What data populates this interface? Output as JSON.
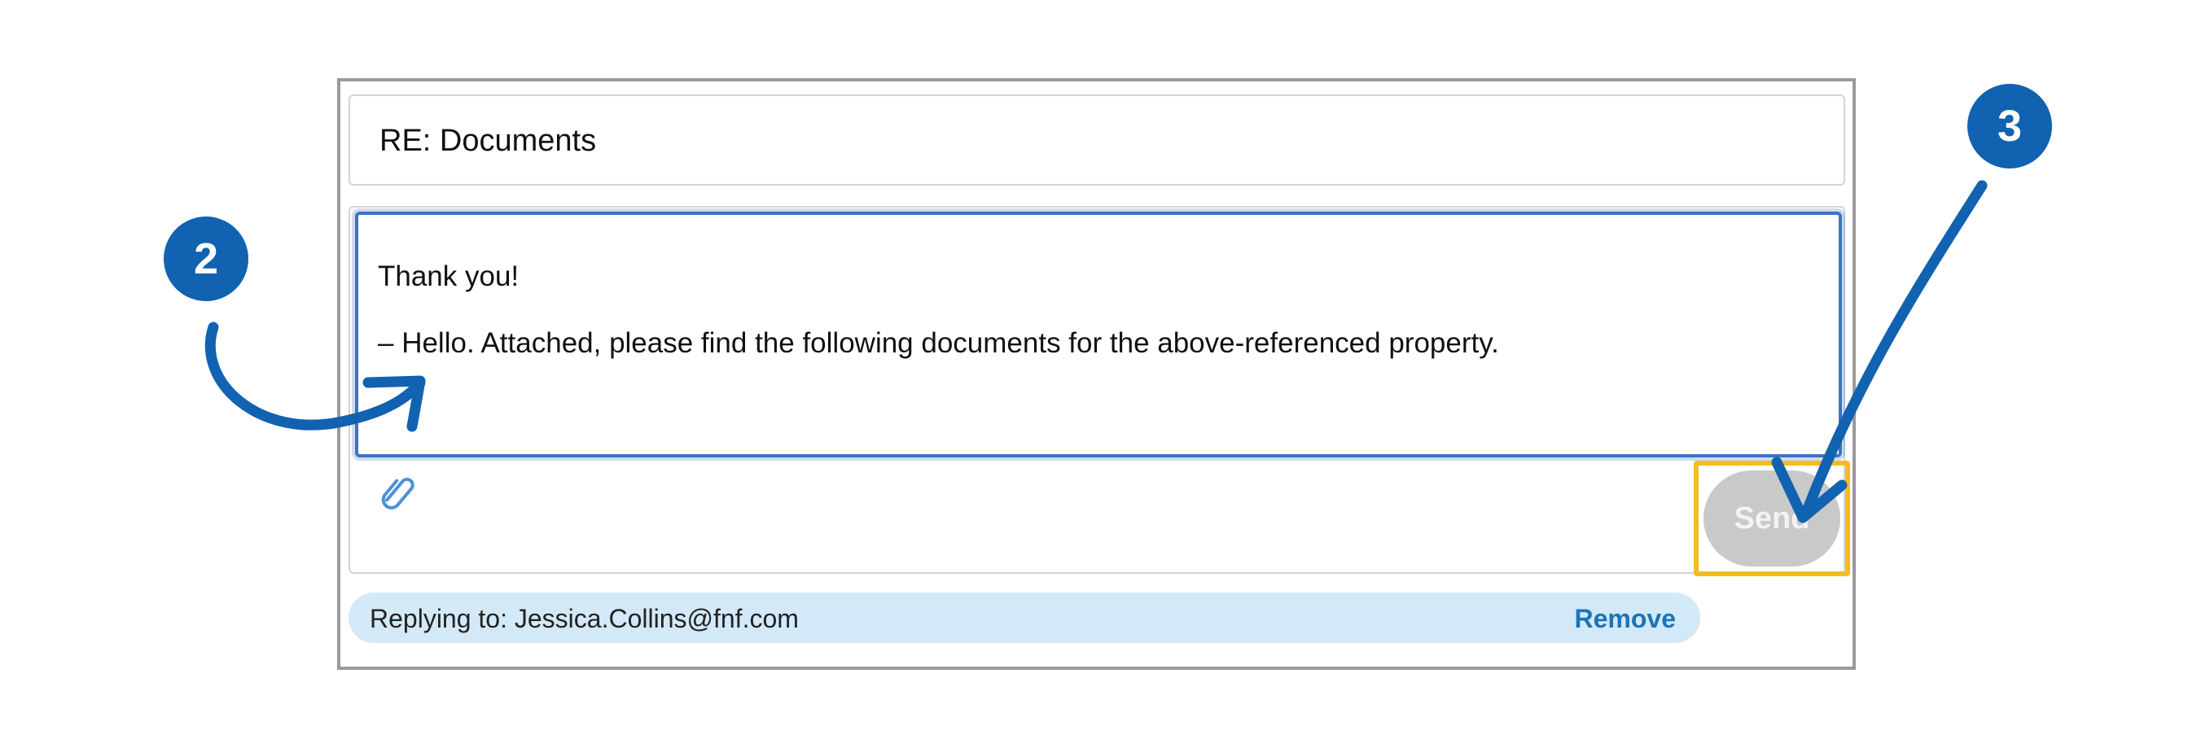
{
  "subject": {
    "value": "RE: Documents"
  },
  "message": {
    "line1": "Thank you!",
    "line2": "– Hello. Attached, please find the following documents for the above-referenced property."
  },
  "toolbar": {
    "attach_icon": "paperclip-icon",
    "send_label": "Send"
  },
  "reply": {
    "text": "Replying to: Jessica.Collins@fnf.com",
    "remove_label": "Remove"
  },
  "annotations": {
    "step2_label": "2",
    "step3_label": "3",
    "step_color": "#1162b1",
    "highlight_color": "#f3bd22"
  }
}
